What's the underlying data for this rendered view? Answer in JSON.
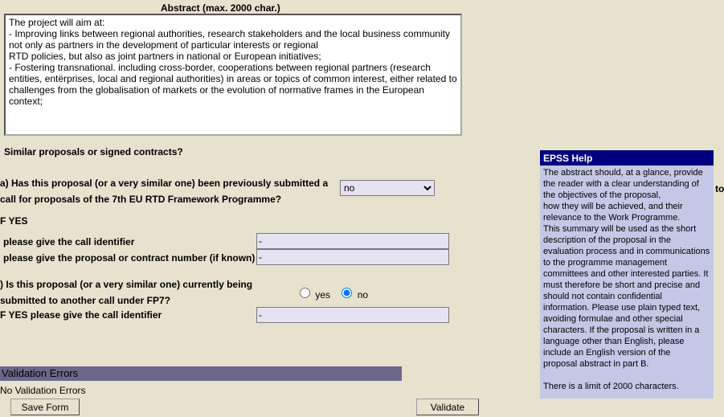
{
  "abstract": {
    "label": "Abstract (max. 2000 char.)",
    "text": "The project will aim at:\n- Improving links between regional authorities, research stakeholders and the local business community not only as partners in the development of particular interests or regional\nRTD policies, but also as joint partners in national or European initiatives;\n- Fostering transnational. including cross-border, cooperations between regional partners (research entities, entërprises, local and regional authorities) in areas or topics of common interest, either related to challenges from the globalisation of markets or the evolution of normative frames in the European context;"
  },
  "similar": {
    "heading": "Similar proposals or signed contracts?",
    "question_a": "a) Has this proposal (or a very similar one) been previously submitted a call for proposals of the 7th EU RTD Framework Programme?",
    "select_a_value": "no",
    "if_yes_label": "F YES",
    "call_id_label": "please give the call identifier",
    "call_id_value": "-",
    "prop_num_label": "please give the proposal or contract number (if known)",
    "prop_num_value": "-",
    "question_b": ") Is this proposal (or a very similar one) currently being submitted to another call under FP7?",
    "radio_yes": "yes",
    "radio_no": "no",
    "if_yes2_label": "F YES please give the call identifier",
    "if_yes2_value": "-"
  },
  "validation": {
    "header": "Validation Errors",
    "message": "No Validation Errors"
  },
  "buttons": {
    "save": "Save Form",
    "validate": "Validate"
  },
  "help": {
    "title": "EPSS Help",
    "body": "The abstract should, at a glance, provide the reader with a clear understanding of the objectives of the proposal,\nhow they will be achieved, and their relevance to the Work Programme.\nThis summary will be used as the short description of the proposal in the evaluation process and in communications\nto the programme management committees and other interested parties. It must therefore be short and precise and\nshould not contain confidential information. Please use plain typed text, avoiding formulae and other special\ncharacters. If the proposal is written in a language other than English, please include an English version of the\nproposal abstract in part B.\n\nThere is a limit of 2000 characters."
  },
  "fragment_to": "to"
}
